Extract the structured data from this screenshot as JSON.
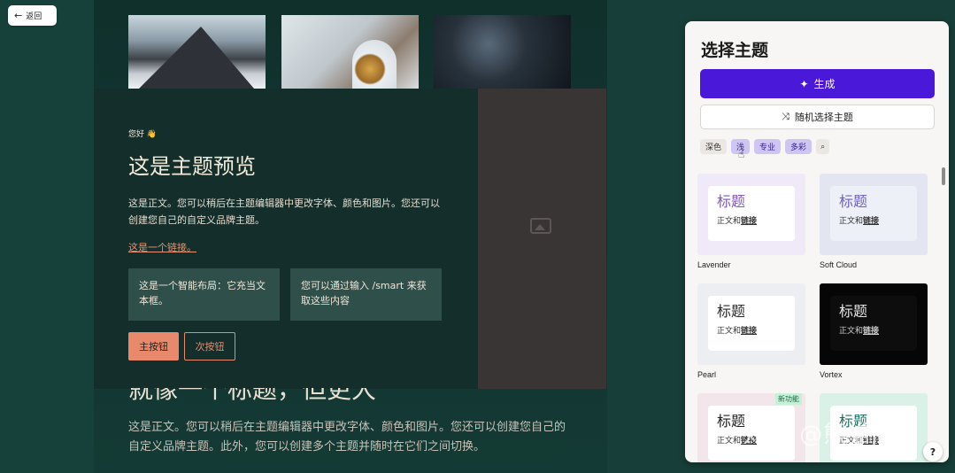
{
  "nav": {
    "back_label": "返回"
  },
  "doc": {
    "greeting": "您好 👋",
    "title": "这是主题预览",
    "body": "这是正文。您可以稍后在主题编辑器中更改字体、颜色和图片。您还可以创建您自己的自定义品牌主题。",
    "link": "这是一个链接。",
    "smart_1": "这是一个智能布局：它充当文本框。",
    "smart_2": "您可以通过输入 /smart 来获取这些内容",
    "primary_btn": "主按钮",
    "secondary_btn": "次按钮",
    "big_title": "就像一个标题，但更大",
    "long_body": "这是正文。您可以稍后在主题编辑器中更改字体、颜色和图片。您还可以创建您自己的自定义品牌主题。此外，您可以创建多个主题并随时在它们之间切换。"
  },
  "theme_panel": {
    "title": "选择主题",
    "generate_label": "生成",
    "random_label": "随机选择主题",
    "filters": [
      {
        "label": "深色",
        "active": false
      },
      {
        "label": "浅",
        "active": true
      },
      {
        "label": "专业",
        "active": true
      },
      {
        "label": "多彩",
        "active": true
      }
    ],
    "themes": [
      {
        "name": "Lavender",
        "heading": "标题",
        "body_prefix": "正文和",
        "link_word": "链接",
        "bg": "#efe9f8",
        "inner_bg": "#ffffff",
        "text": "#7e57c2",
        "body_color": "#333333",
        "badge": ""
      },
      {
        "name": "Soft Cloud",
        "heading": "标题",
        "body_prefix": "正文和",
        "link_word": "链接",
        "bg": "#e3e6f0",
        "inner_bg": "#eef0f8",
        "text": "#6b61c7",
        "body_color": "#333333",
        "badge": ""
      },
      {
        "name": "Pearl",
        "heading": "标题",
        "body_prefix": "正文和",
        "link_word": "链接",
        "bg": "#eceef2",
        "inner_bg": "#ffffff",
        "text": "#2a2a2a",
        "body_color": "#333333",
        "badge": ""
      },
      {
        "name": "Vortex",
        "heading": "标题",
        "body_prefix": "正文和",
        "link_word": "链接",
        "bg": "#060606",
        "inner_bg": "#0d0d0d",
        "text": "#e6e6e6",
        "body_color": "#cccccc",
        "badge": ""
      },
      {
        "name": "",
        "heading": "标题",
        "body_prefix": "正文和",
        "link_word": "链接",
        "bg": "#f3e6ea",
        "inner_bg": "#ffffff",
        "text": "#222222",
        "body_color": "#333333",
        "badge": "新功能"
      },
      {
        "name": "",
        "heading": "标题",
        "body_prefix": "正文和",
        "link_word": "链接",
        "bg": "#d9f1e6",
        "inner_bg": "#ffffff",
        "text": "#1e6e62",
        "body_color": "#333333",
        "badge": ""
      }
    ]
  },
  "watermark": "知乎 @熊猫Jay",
  "help_label": "?",
  "icons": {
    "back": "arrow-left-icon",
    "generate": "sparkle-icon",
    "random": "shuffle-icon",
    "search": "search-icon",
    "image": "image-placeholder-icon"
  }
}
